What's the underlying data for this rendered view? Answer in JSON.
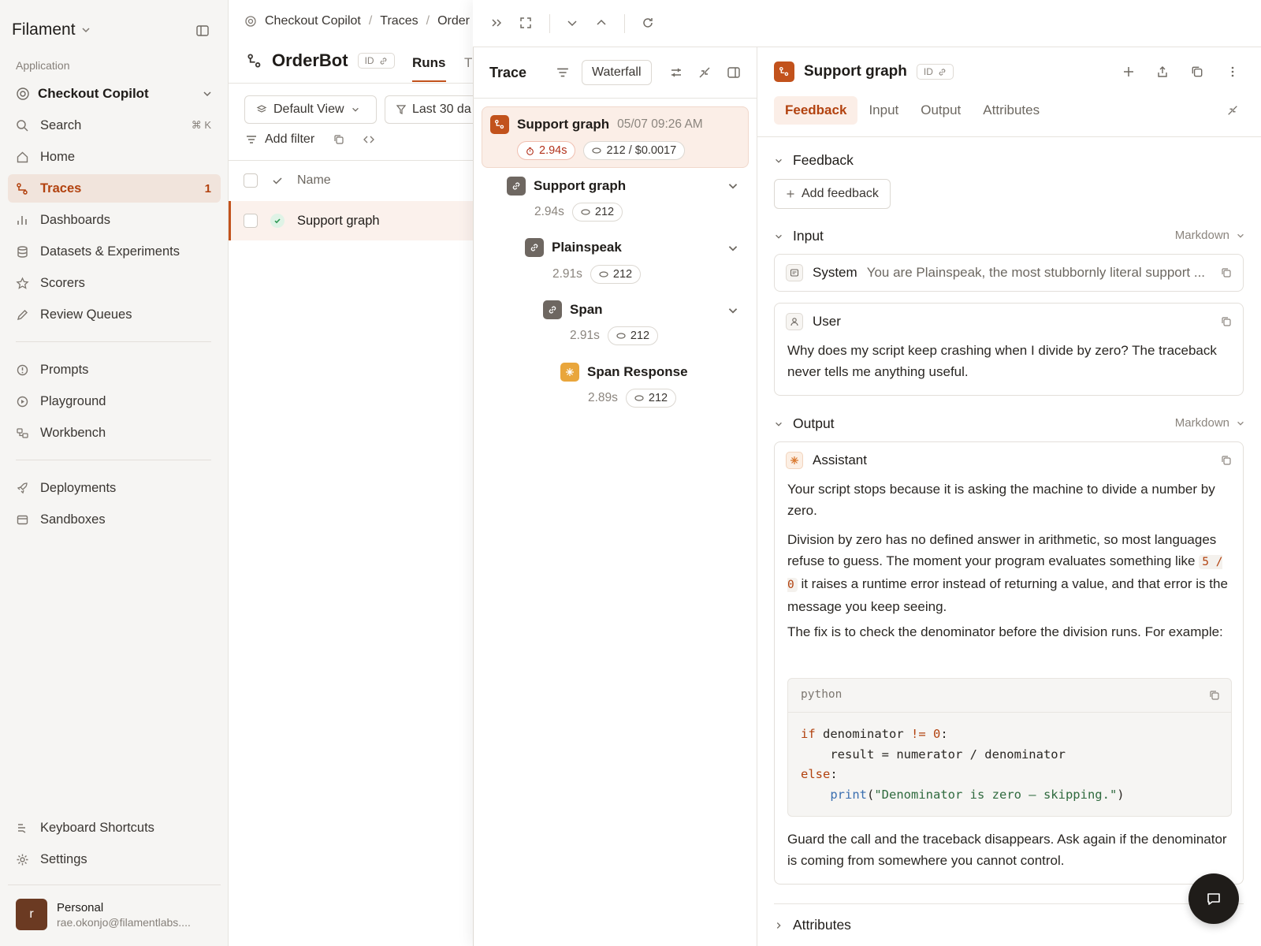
{
  "sidebar": {
    "brand": "Filament",
    "section_label": "Application",
    "app_name": "Checkout Copilot",
    "search": {
      "label": "Search",
      "shortcut": "⌘ K"
    },
    "nav_primary": [
      {
        "label": "Home",
        "icon": "home-icon"
      },
      {
        "label": "Traces",
        "icon": "traces-icon",
        "count": "1",
        "active": true
      },
      {
        "label": "Dashboards",
        "icon": "bar-chart-icon"
      },
      {
        "label": "Datasets & Experiments",
        "icon": "database-icon"
      },
      {
        "label": "Scorers",
        "icon": "star-icon"
      },
      {
        "label": "Review Queues",
        "icon": "pencil-icon"
      }
    ],
    "nav_secondary": [
      {
        "label": "Prompts",
        "icon": "info-circle-icon"
      },
      {
        "label": "Playground",
        "icon": "play-circle-icon"
      },
      {
        "label": "Workbench",
        "icon": "workbench-icon"
      }
    ],
    "nav_tertiary": [
      {
        "label": "Deployments",
        "icon": "rocket-icon"
      },
      {
        "label": "Sandboxes",
        "icon": "box-icon"
      }
    ],
    "footer": [
      {
        "label": "Keyboard Shortcuts",
        "icon": "keyboard-icon"
      },
      {
        "label": "Settings",
        "icon": "gear-icon"
      }
    ],
    "user": {
      "initial": "r",
      "name": "Personal",
      "email": "rae.okonjo@filamentlabs...."
    }
  },
  "main": {
    "breadcrumb": [
      "Checkout Copilot",
      "Traces",
      "Order"
    ],
    "title": "OrderBot",
    "id_label": "ID",
    "tabs": [
      "Runs",
      "T"
    ],
    "view_select": "Default View",
    "date_filter": "Last 30 da",
    "add_filter": "Add filter",
    "table": {
      "header_name": "Name",
      "rows": [
        {
          "name": "Support graph",
          "status": "success"
        }
      ]
    }
  },
  "trace": {
    "title": "Trace",
    "view_mode": "Waterfall",
    "root": {
      "name": "Support graph",
      "timestamp": "05/07 09:26 AM",
      "duration": "2.94s",
      "tokens_cost": "212 / $0.0017"
    },
    "nodes": [
      {
        "name": "Support graph",
        "duration": "2.94s",
        "tokens": "212"
      },
      {
        "name": "Plainspeak",
        "duration": "2.91s",
        "tokens": "212"
      },
      {
        "name": "Span",
        "duration": "2.91s",
        "tokens": "212"
      },
      {
        "name": "Span Response",
        "duration": "2.89s",
        "tokens": "212"
      }
    ]
  },
  "detail": {
    "title": "Support graph",
    "id_label": "ID",
    "tabs": [
      "Feedback",
      "Input",
      "Output",
      "Attributes"
    ],
    "feedback": {
      "heading": "Feedback",
      "add_button": "Add feedback"
    },
    "input": {
      "heading": "Input",
      "format": "Markdown",
      "system": {
        "role": "System",
        "text": "You are Plainspeak, the most stubbornly literal support ..."
      },
      "user": {
        "role": "User",
        "text": "Why does my script keep crashing when I divide by zero? The traceback never tells me anything useful."
      }
    },
    "output": {
      "heading": "Output",
      "format": "Markdown",
      "role": "Assistant",
      "para1": "Your script stops because it is asking the machine to divide a number by zero.",
      "para2_a": "Division by zero has no defined answer in arithmetic, so most languages refuse to guess. The moment your program evaluates something like ",
      "para2_code": "5 / 0",
      "para2_b": " it raises a runtime error instead of returning a value, and that error is the message you keep seeing.",
      "para3": "The fix is to check the denominator before the division runs. For example:",
      "code_lang": "python",
      "code": {
        "l1_kw": "if",
        "l1_rest": " denominator ",
        "l1_op": "!=",
        "l1_sp": " ",
        "l1_num": "0",
        "l1_end": ":",
        "l2": "    result = numerator / denominator",
        "l3_kw": "else",
        "l3_end": ":",
        "l4_indent": "    ",
        "l4_fn": "print",
        "l4_open": "(",
        "l4_str": "\"Denominator is zero — skipping.\"",
        "l4_close": ")"
      },
      "para4": "Guard the call and the traceback disappears. Ask again if the denominator is coming from somewhere you cannot control."
    },
    "attributes": {
      "heading": "Attributes"
    }
  }
}
